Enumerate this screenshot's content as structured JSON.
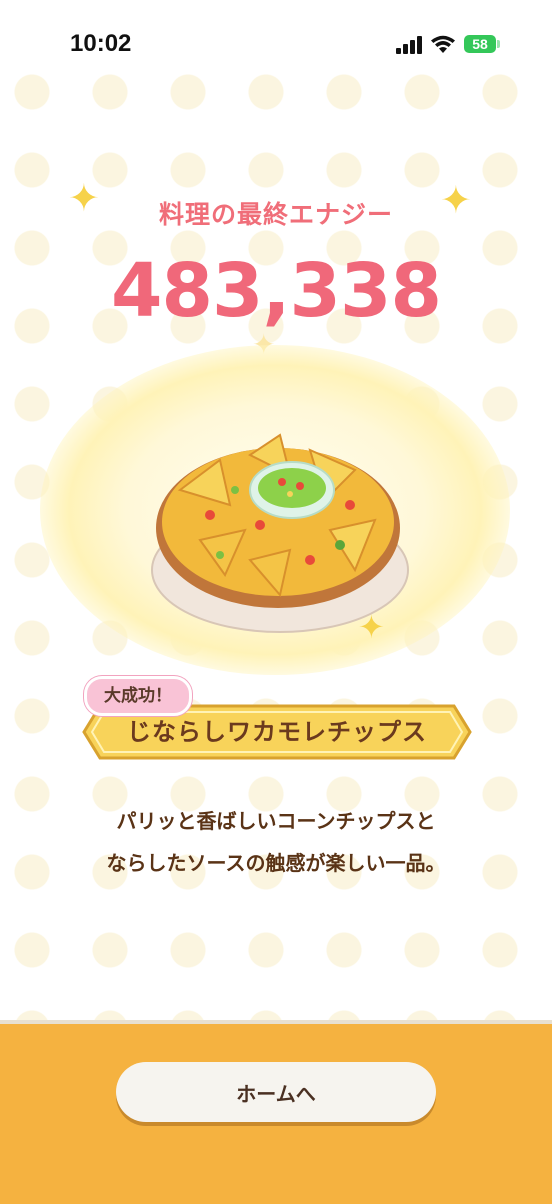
{
  "status_bar": {
    "time": "10:02",
    "battery_level": "58",
    "icons": [
      "signal-icon",
      "wifi-icon",
      "battery-icon"
    ]
  },
  "result": {
    "energy_label": "料理の最終エナジー",
    "energy_value": "483,338",
    "success_badge": "大成功！",
    "dish_name": "じならしワカモレチップス",
    "description_line1": "パリッと香ばしいコーンチップスと",
    "description_line2": "ならしたソースの触感が楽しい一品。"
  },
  "footer": {
    "home_button_label": "ホームへ"
  },
  "colors": {
    "accent_pink": "#f06e79",
    "footer_orange": "#f5b240",
    "ribbon_yellow": "#f8d35a",
    "text_brown": "#5a3316"
  }
}
